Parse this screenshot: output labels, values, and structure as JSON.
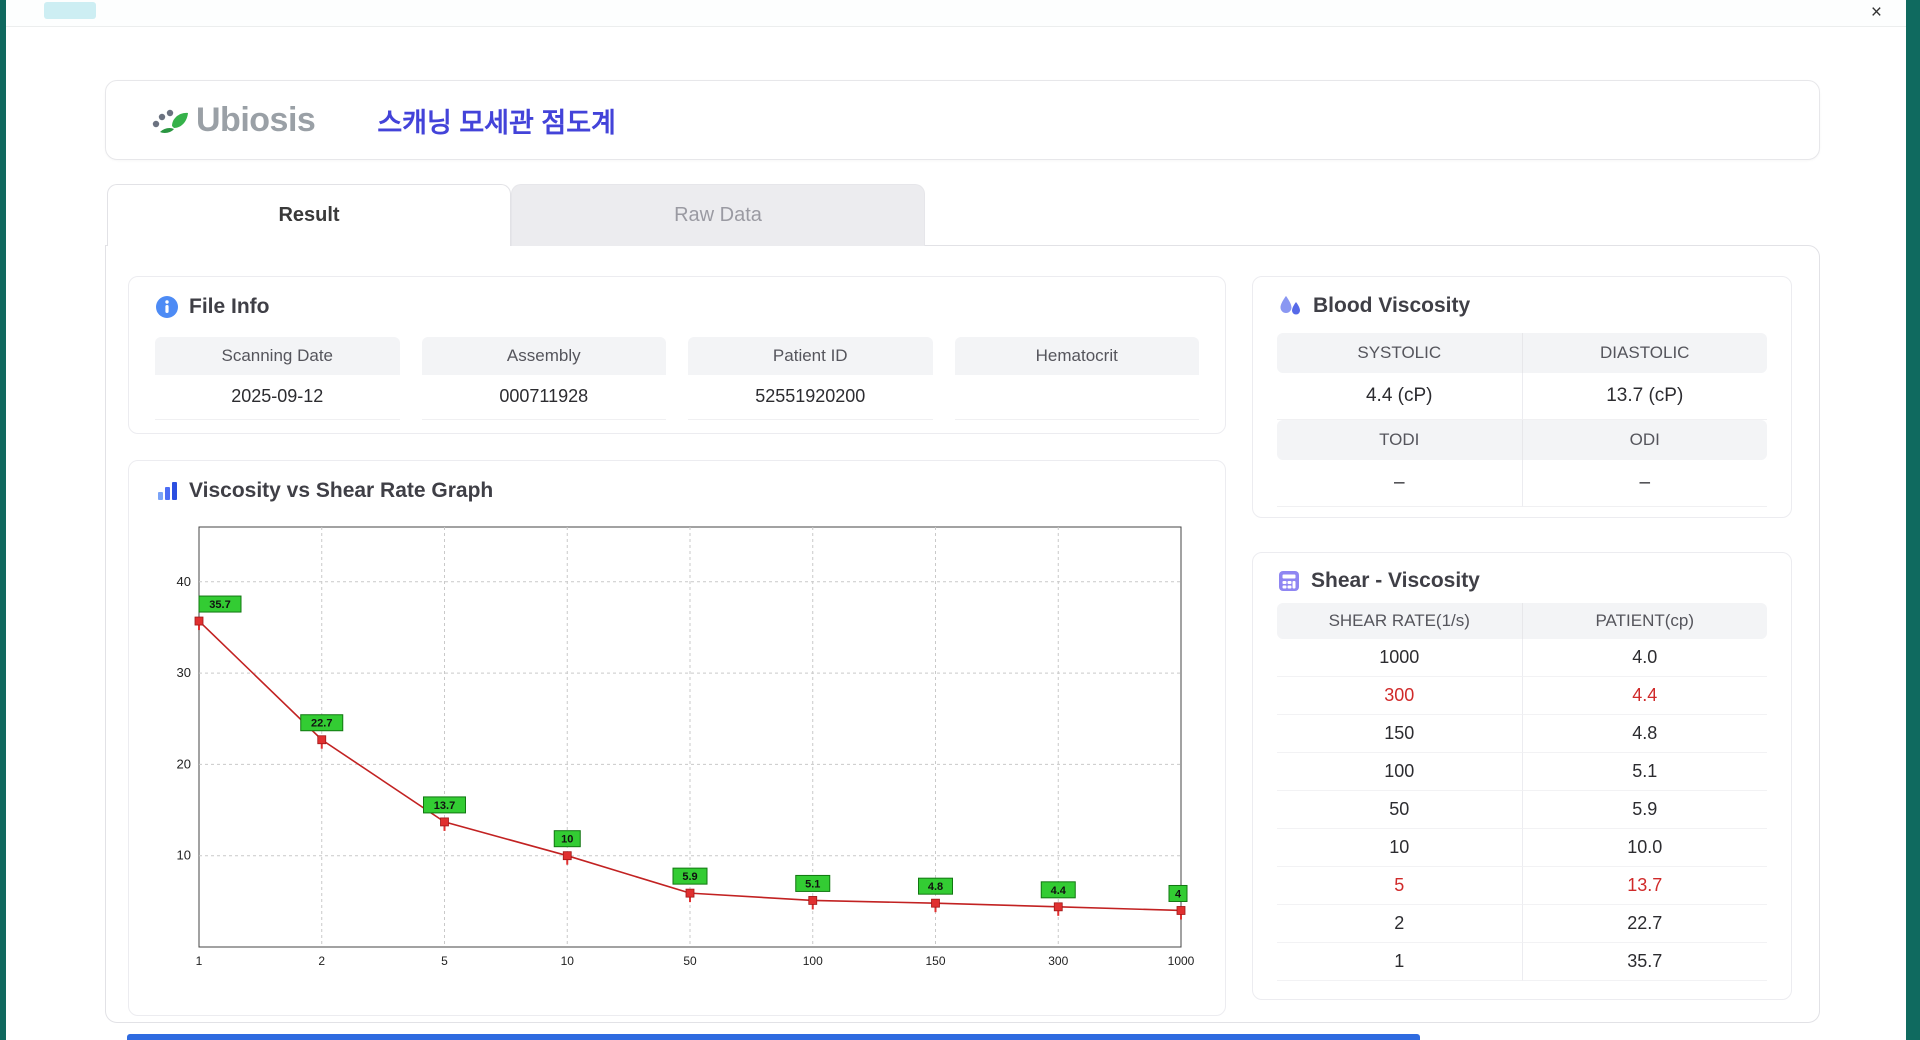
{
  "window": {
    "close_icon": "×"
  },
  "header": {
    "logo_text": "Ubiosis",
    "title": "스캐닝 모세관 점도계"
  },
  "tabs": [
    {
      "label": "Result",
      "active": true
    },
    {
      "label": "Raw Data",
      "active": false
    }
  ],
  "file_info": {
    "title": "File Info",
    "fields": [
      {
        "label": "Scanning Date",
        "value": "2025-09-12"
      },
      {
        "label": "Assembly",
        "value": "000711928"
      },
      {
        "label": "Patient ID",
        "value": "52551920200"
      },
      {
        "label": "Hematocrit",
        "value": ""
      }
    ]
  },
  "blood_viscosity": {
    "title": "Blood Viscosity",
    "rows": [
      {
        "labels": [
          "SYSTOLIC",
          "DIASTOLIC"
        ],
        "values": [
          "4.4 (cP)",
          "13.7 (cP)"
        ]
      },
      {
        "labels": [
          "TODI",
          "ODI"
        ],
        "values": [
          "–",
          "–"
        ]
      }
    ]
  },
  "graph": {
    "title": "Viscosity vs Shear Rate Graph"
  },
  "chart_data": {
    "type": "line",
    "title": "Viscosity vs Shear Rate Graph",
    "x": [
      1,
      2,
      5,
      10,
      50,
      100,
      150,
      300,
      1000
    ],
    "x_tick_labels": [
      "1",
      "2",
      "5",
      "10",
      "50",
      "100",
      "150",
      "300",
      "1000"
    ],
    "values": [
      35.7,
      22.7,
      13.7,
      10,
      5.9,
      5.1,
      4.8,
      4.4,
      4
    ],
    "point_labels": [
      "35.7",
      "22.7",
      "13.7",
      "10",
      "5.9",
      "5.1",
      "4.8",
      "4.4",
      "4"
    ],
    "yticks": [
      10,
      20,
      30,
      40
    ],
    "ylim": [
      0,
      46
    ],
    "xlabel": "",
    "ylabel": "",
    "grid": true,
    "x_scale": "category",
    "line_color": "#c22222",
    "marker_color": "#e03030",
    "label_bg": "#33cc33",
    "label_border": "#117711"
  },
  "shear_viscosity": {
    "title": "Shear - Viscosity",
    "columns": [
      "SHEAR RATE(1/s)",
      "PATIENT(cp)"
    ],
    "rows": [
      {
        "shear": "1000",
        "patient": "4.0",
        "highlight": false
      },
      {
        "shear": "300",
        "patient": "4.4",
        "highlight": true
      },
      {
        "shear": "150",
        "patient": "4.8",
        "highlight": false
      },
      {
        "shear": "100",
        "patient": "5.1",
        "highlight": false
      },
      {
        "shear": "50",
        "patient": "5.9",
        "highlight": false
      },
      {
        "shear": "10",
        "patient": "10.0",
        "highlight": false
      },
      {
        "shear": "5",
        "patient": "13.7",
        "highlight": true
      },
      {
        "shear": "2",
        "patient": "22.7",
        "highlight": false
      },
      {
        "shear": "1",
        "patient": "35.7",
        "highlight": false
      }
    ]
  },
  "colors": {
    "accent_blue": "#4343d9",
    "highlight_red": "#d02a2a",
    "teal_edge": "#0f685e",
    "bottom_bar_blue": "#2f6be0"
  }
}
